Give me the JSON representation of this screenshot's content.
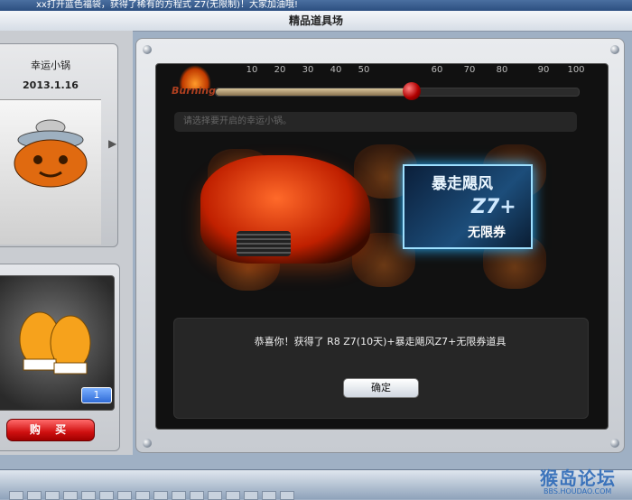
{
  "ticker": "xx打开蓝色福袋，获得了稀有的方程式 Z7(无限制)！大家加油哦!",
  "title": "精品道具场",
  "left": {
    "card_name": "幸运小锅",
    "card_date": "2013.1.16",
    "qty": "1",
    "buy_label": "购 买"
  },
  "progress": {
    "label": "Burning",
    "ticks": [
      "10",
      "20",
      "30",
      "40",
      "50",
      "60",
      "70",
      "80",
      "90",
      "100"
    ],
    "value_percent": 54
  },
  "hint": "请选择要开启的幸运小锅。",
  "coupon": {
    "title": "暴走飓风",
    "model": "Z7+",
    "subtitle": "无限券"
  },
  "dialog": {
    "message": "恭喜你！获得了 R8 Z7(10天)+暴走飓风Z7+无限券道具",
    "ok_label": "确定"
  },
  "watermark": {
    "text": "猴岛论坛",
    "url": "BBS.HOUDAO.COM"
  }
}
